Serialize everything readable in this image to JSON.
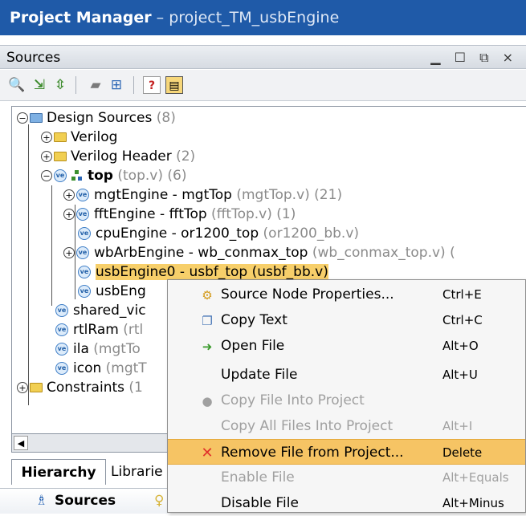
{
  "window": {
    "title_bold": "Project Manager",
    "title_rest": " – project_TM_usbEngine"
  },
  "panel": {
    "title": "Sources",
    "controls": "▁ ☐ ⧉ ×"
  },
  "toolbar": {
    "icons": [
      "search-icon",
      "collapse-all-icon",
      "expand-all-icon",
      "folder-icon",
      "add-sources-icon",
      "help-icon",
      "properties-icon"
    ]
  },
  "tree": {
    "design_sources": {
      "label": "Design Sources",
      "count": " (8)"
    },
    "verilog": {
      "label": "Verilog"
    },
    "verilog_header": {
      "label": "Verilog Header",
      "count": " (2)"
    },
    "top": {
      "label": "top",
      "detail": " (top.v) (6)"
    },
    "mgt": {
      "label": "mgtEngine - mgtTop",
      "detail": " (mgtTop.v) (21)"
    },
    "fft": {
      "label": "fftEngine - fftTop",
      "detail": " (fftTop.v) (1)"
    },
    "cpu": {
      "label": "cpuEngine - or1200_top",
      "detail": " (or1200_bb.v)"
    },
    "wbarb": {
      "label": "wbArbEngine - wb_conmax_top",
      "detail": " (wb_conmax_top.v) ("
    },
    "usb0": {
      "label": "usbEngine0 - usbf_top (usbf_bb.v)"
    },
    "usb1": {
      "label": "usbEng"
    },
    "shared": {
      "label": "shared_vic"
    },
    "rtlram": {
      "label": "rtlRam",
      "detail": " (rtl"
    },
    "ila": {
      "label": "ila",
      "detail": " (mgtTo"
    },
    "icon": {
      "label": "icon",
      "detail": " (mgtT"
    },
    "constraints": {
      "label": "Constraints",
      "detail": " (1"
    }
  },
  "tabs": {
    "hierarchy": "Hierarchy",
    "libraries": "Librarie",
    "sources": "Sources"
  },
  "context_menu": {
    "items": [
      {
        "label": "Source Node Properties...",
        "shortcut": "Ctrl+E"
      },
      {
        "label": "Copy Text",
        "shortcut": "Ctrl+C"
      },
      {
        "label": "Open File",
        "shortcut": "Alt+O"
      },
      {
        "label": "Update File",
        "shortcut": "Alt+U"
      },
      {
        "label": "Copy File Into Project",
        "shortcut": ""
      },
      {
        "label": "Copy All Files Into Project",
        "shortcut": "Alt+I"
      },
      {
        "label": "Remove File from Project...",
        "shortcut": "Delete"
      },
      {
        "label": "Enable File",
        "shortcut": "Alt+Equals"
      },
      {
        "label": "Disable File",
        "shortcut": "Alt+Minus"
      }
    ]
  },
  "colors": {
    "title_bar": "#1f5aa8",
    "highlight": "#f6c464",
    "remove_icon": "#e0312b"
  }
}
